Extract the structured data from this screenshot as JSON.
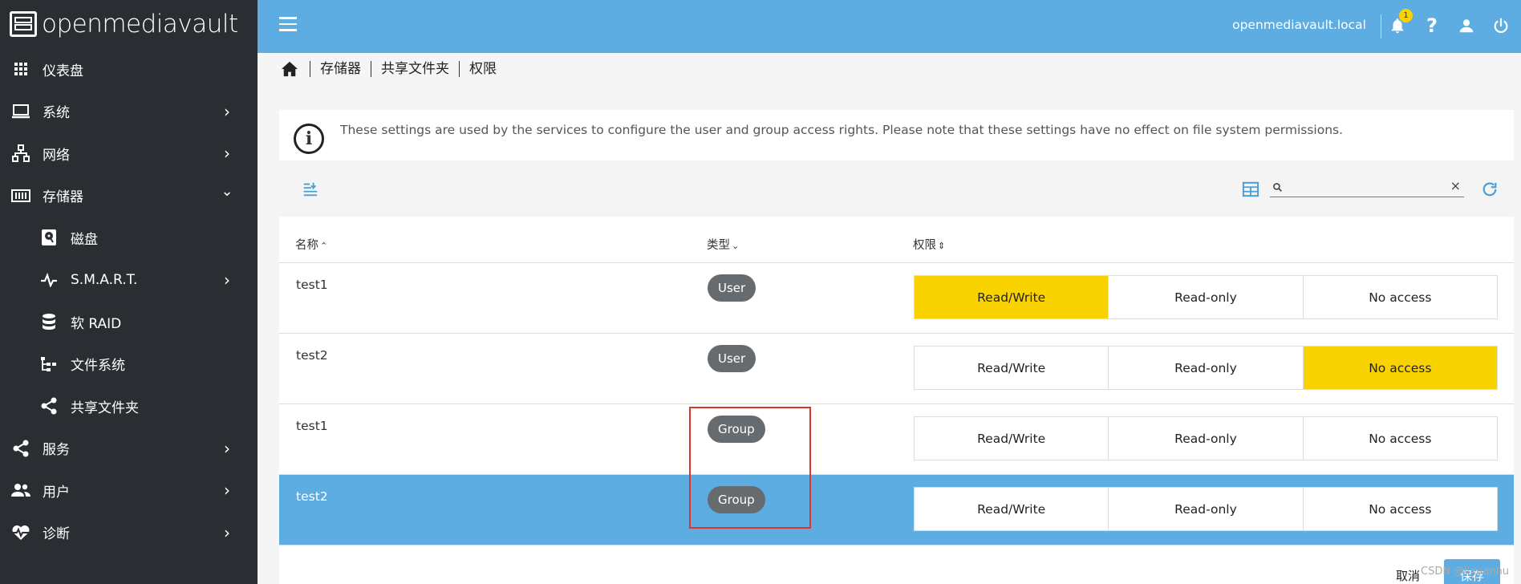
{
  "brand": {
    "name": "openmediavault"
  },
  "sidebar": {
    "items": [
      {
        "label": "仪表盘",
        "icon": "grid-icon",
        "has_chevron": false
      },
      {
        "label": "系统",
        "icon": "laptop-icon",
        "chevron": "›"
      },
      {
        "label": "网络",
        "icon": "network-icon",
        "chevron": "›"
      },
      {
        "label": "存储器",
        "icon": "storage-icon",
        "chevron": "⌄"
      },
      {
        "label": "磁盘",
        "icon": "disk-icon",
        "sub": true
      },
      {
        "label": "S.M.A.R.T.",
        "icon": "pulse-icon",
        "sub": true,
        "chevron": "›"
      },
      {
        "label": "软 RAID",
        "icon": "database-icon",
        "sub": true
      },
      {
        "label": "文件系统",
        "icon": "filesystem-icon",
        "sub": true
      },
      {
        "label": "共享文件夹",
        "icon": "share-icon",
        "sub": true
      },
      {
        "label": "服务",
        "icon": "share-icon",
        "chevron": "›"
      },
      {
        "label": "用户",
        "icon": "users-icon",
        "chevron": "›"
      },
      {
        "label": "诊断",
        "icon": "heartbeat-icon",
        "chevron": "›"
      }
    ]
  },
  "topbar": {
    "hostname": "openmediavault.local",
    "notification_count": "1"
  },
  "breadcrumb": {
    "items": [
      "存储器",
      "共享文件夹",
      "权限"
    ]
  },
  "info": {
    "text": "These settings are used by the services to configure the user and group access rights. Please note that these settings have no effect on file system permissions."
  },
  "table": {
    "columns": {
      "name": "名称",
      "name_sort": "⌃",
      "type": "类型",
      "type_sort": "⌄",
      "perm": "权限",
      "perm_sort": "⇕"
    },
    "perm_options": [
      "Read/Write",
      "Read-only",
      "No access"
    ],
    "rows": [
      {
        "name": "test1",
        "type": "User",
        "active": 0
      },
      {
        "name": "test2",
        "type": "User",
        "active": 2
      },
      {
        "name": "test1",
        "type": "Group",
        "active": -1
      },
      {
        "name": "test2",
        "type": "Group",
        "active": -1,
        "selected": true
      }
    ]
  },
  "footer": {
    "cancel": "取消",
    "save": "保存",
    "watermark": "CSDN @lixuanhu"
  },
  "colors": {
    "accent": "#5dade2",
    "sidebar": "#2a2e33",
    "active_perm": "#f9d300",
    "chip": "#666b70"
  }
}
